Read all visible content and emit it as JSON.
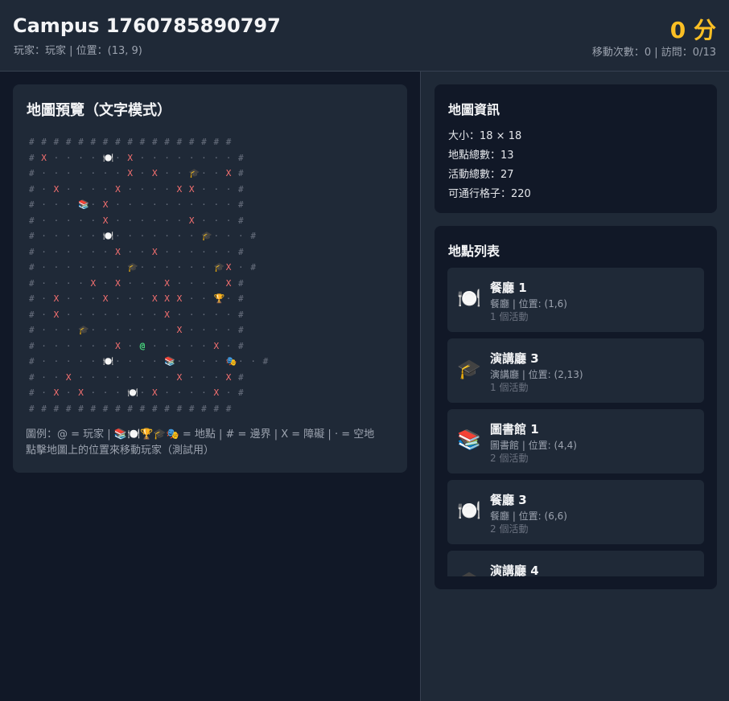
{
  "header": {
    "title": "Campus 1760785890797",
    "subtitle": "玩家：玩家 | 位置：(13, 9)",
    "score": "0 分",
    "stats": "移動次數：0 | 訪問：0/13"
  },
  "map": {
    "title": "地圖預覽（文字模式）",
    "rows": [
      [
        "#",
        "#",
        "#",
        "#",
        "#",
        "#",
        "#",
        "#",
        "#",
        "#",
        "#",
        "#",
        "#",
        "#",
        "#",
        "#",
        "#"
      ],
      [
        "#",
        "X",
        "·",
        "·",
        "·",
        "·",
        "🍽️",
        "·",
        "X",
        "·",
        "·",
        "·",
        "·",
        "·",
        "·",
        "·",
        "·",
        "#"
      ],
      [
        "#",
        "·",
        "·",
        "·",
        "·",
        "·",
        "·",
        "·",
        "X",
        "·",
        "X",
        "·",
        "·",
        "🎓",
        "·",
        "·",
        "X",
        "#"
      ],
      [
        "#",
        "·",
        "X",
        "·",
        "·",
        "·",
        "·",
        "X",
        "·",
        "·",
        "·",
        "·",
        "X",
        "X",
        "·",
        "·",
        "·",
        "#"
      ],
      [
        "#",
        "·",
        "·",
        "·",
        "📚",
        "·",
        "X",
        "·",
        "·",
        "·",
        "·",
        "·",
        "·",
        "·",
        "·",
        "·",
        "·",
        "#"
      ],
      [
        "#",
        "·",
        "·",
        "·",
        "·",
        "·",
        "X",
        "·",
        "·",
        "·",
        "·",
        "·",
        "·",
        "X",
        "·",
        "·",
        "·",
        "#"
      ],
      [
        "#",
        "·",
        "·",
        "·",
        "·",
        "·",
        "🍽️",
        "·",
        "·",
        "·",
        "·",
        "·",
        "·",
        "·",
        "🎓",
        "·",
        "·",
        "·",
        "#"
      ],
      [
        "#",
        "·",
        "·",
        "·",
        "·",
        "·",
        "·",
        "X",
        "·",
        "·",
        "X",
        "·",
        "·",
        "·",
        "·",
        "·",
        "·",
        "#"
      ],
      [
        "#",
        "·",
        "·",
        "·",
        "·",
        "·",
        "·",
        "·",
        "🎓",
        "·",
        "·",
        "·",
        "·",
        "·",
        "·",
        "🎓",
        "X",
        "·",
        "#"
      ],
      [
        "#",
        "·",
        "·",
        "·",
        "·",
        "X",
        "·",
        "X",
        "·",
        "·",
        "·",
        "X",
        "·",
        "·",
        "·",
        "·",
        "X",
        "#"
      ],
      [
        "#",
        "·",
        "X",
        "·",
        "·",
        "·",
        "X",
        "·",
        "·",
        "·",
        "X",
        "X",
        "X",
        "·",
        "·",
        "🏆",
        "·",
        "#"
      ],
      [
        "#",
        "·",
        "X",
        "·",
        "·",
        "·",
        "·",
        "·",
        "·",
        "·",
        "·",
        "X",
        "·",
        "·",
        "·",
        "·",
        "·",
        "#"
      ],
      [
        "#",
        "·",
        "·",
        "·",
        "🎓",
        "·",
        "·",
        "·",
        "·",
        "·",
        "·",
        "·",
        "X",
        "·",
        "·",
        "·",
        "·",
        "#"
      ],
      [
        "#",
        "·",
        "·",
        "·",
        "·",
        "·",
        "·",
        "X",
        "·",
        "@",
        "·",
        "·",
        "·",
        "·",
        "·",
        "X",
        "·",
        "#"
      ],
      [
        "#",
        "·",
        "·",
        "·",
        "·",
        "·",
        "🍽️",
        "·",
        "·",
        "·",
        "·",
        "📚",
        "·",
        "·",
        "·",
        "·",
        "🎭",
        "·",
        "·",
        "#"
      ],
      [
        "#",
        "·",
        "·",
        "X",
        "·",
        "·",
        "·",
        "·",
        "·",
        "·",
        "·",
        "·",
        "X",
        "·",
        "·",
        "·",
        "X",
        "#"
      ],
      [
        "#",
        "·",
        "X",
        "·",
        "X",
        "·",
        "·",
        "·",
        "🍽️",
        "·",
        "X",
        "·",
        "·",
        "·",
        "·",
        "X",
        "·",
        "#"
      ],
      [
        "#",
        "#",
        "#",
        "#",
        "#",
        "#",
        "#",
        "#",
        "#",
        "#",
        "#",
        "#",
        "#",
        "#",
        "#",
        "#",
        "#"
      ]
    ],
    "legend_line1": "圖例：@ = 玩家 | 📚🍽️🏆🎓🎭 = 地點 | # = 邊界 | X = 障礙 | · = 空地",
    "legend_line2": "點擊地圖上的位置來移動玩家（測試用）"
  },
  "info": {
    "title": "地圖資訊",
    "size": "大小：18 × 18",
    "locations": "地點總數：13",
    "activities": "活動總數：27",
    "walkable": "可通行格子：220"
  },
  "list": {
    "title": "地點列表",
    "items": [
      {
        "icon": "🍽️",
        "icon_name": "dining-icon",
        "name": "餐廳 1",
        "meta": "餐廳 | 位置: (1,6)",
        "count": "1 個活動"
      },
      {
        "icon": "🎓",
        "icon_name": "graduation-cap-icon",
        "name": "演講廳 3",
        "meta": "演講廳 | 位置: (2,13)",
        "count": "1 個活動"
      },
      {
        "icon": "📚",
        "icon_name": "books-icon",
        "name": "圖書館 1",
        "meta": "圖書館 | 位置: (4,4)",
        "count": "2 個活動"
      },
      {
        "icon": "🍽️",
        "icon_name": "dining-icon",
        "name": "餐廳 3",
        "meta": "餐廳 | 位置: (6,6)",
        "count": "2 個活動"
      },
      {
        "icon": "🎓",
        "icon_name": "graduation-cap-icon",
        "name": "演講廳 4",
        "meta": "",
        "count": ""
      }
    ]
  }
}
